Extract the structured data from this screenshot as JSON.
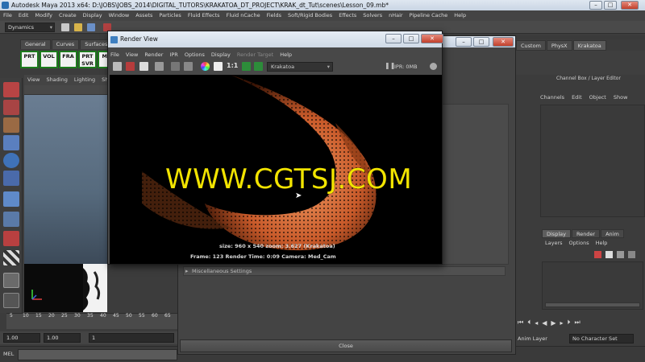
{
  "window": {
    "title": "Autodesk Maya 2013 x64: D:\\JOBS\\JOBS_2014\\DIGITAL_TUTORS\\KRAKATOA_DT_PROJECT\\KRAK_dt_Tut\\scenes\\Lesson_09.mb*"
  },
  "menubar": [
    "File",
    "Edit",
    "Modify",
    "Create",
    "Display",
    "Window",
    "Assets",
    "Particles",
    "Fluid Effects",
    "Fluid nCache",
    "Fields",
    "Soft/Rigid Bodies",
    "Effects",
    "Solvers",
    "nHair",
    "Pipeline Cache",
    "Help"
  ],
  "statusline": {
    "mode": "Dynamics"
  },
  "shelf": {
    "tabs": [
      "General",
      "Curves",
      "Surfaces"
    ],
    "buttons": [
      {
        "line1": "PRT",
        "line2": ""
      },
      {
        "line1": "VOL",
        "line2": ""
      },
      {
        "line1": "FRA",
        "line2": ""
      },
      {
        "line1": "PRT",
        "line2": "SVR"
      },
      {
        "line1": "MO",
        "line2": ""
      }
    ]
  },
  "right_shelf_tabs": [
    "Custom",
    "PhysX",
    "Krakatoa"
  ],
  "viewport": {
    "menu": [
      "View",
      "Shading",
      "Lighting",
      "Sh"
    ]
  },
  "timeline": {
    "ticks": [
      "5",
      "10",
      "15",
      "20",
      "25",
      "30",
      "35",
      "40",
      "45",
      "50",
      "55",
      "60",
      "65"
    ]
  },
  "range": {
    "start": "1.00",
    "current": "1.00",
    "frame_field": "1"
  },
  "cmdline": {
    "label": "MEL"
  },
  "render_settings": {
    "misc_section": "Miscellaneous Settings",
    "close_label": "Close"
  },
  "render_view": {
    "title": "Render View",
    "menu": [
      "File",
      "View",
      "Render",
      "IPR",
      "Options",
      "Display",
      "Render Target",
      "Help"
    ],
    "ratio_label": "1:1",
    "renderer": "Krakatoa",
    "ipr": "IPR: 0MB",
    "info_line1": "size: 960 x 540  zoom: 3.627      (Krakatoa)",
    "info_line2": "Frame: 123      Render Time: 0:09       Camera: Med_Cam"
  },
  "channel_box": {
    "title": "Channel Box / Layer Editor",
    "menu": [
      "Channels",
      "Edit",
      "Object",
      "Show"
    ]
  },
  "layer_editor": {
    "tabs": [
      "Display",
      "Render",
      "Anim"
    ],
    "menu": [
      "Layers",
      "Options",
      "Help"
    ]
  },
  "playback": {
    "anim_layer": "Anim Layer",
    "character": "No Character Set"
  },
  "watermark": "WWW.CGTSJ.COM"
}
